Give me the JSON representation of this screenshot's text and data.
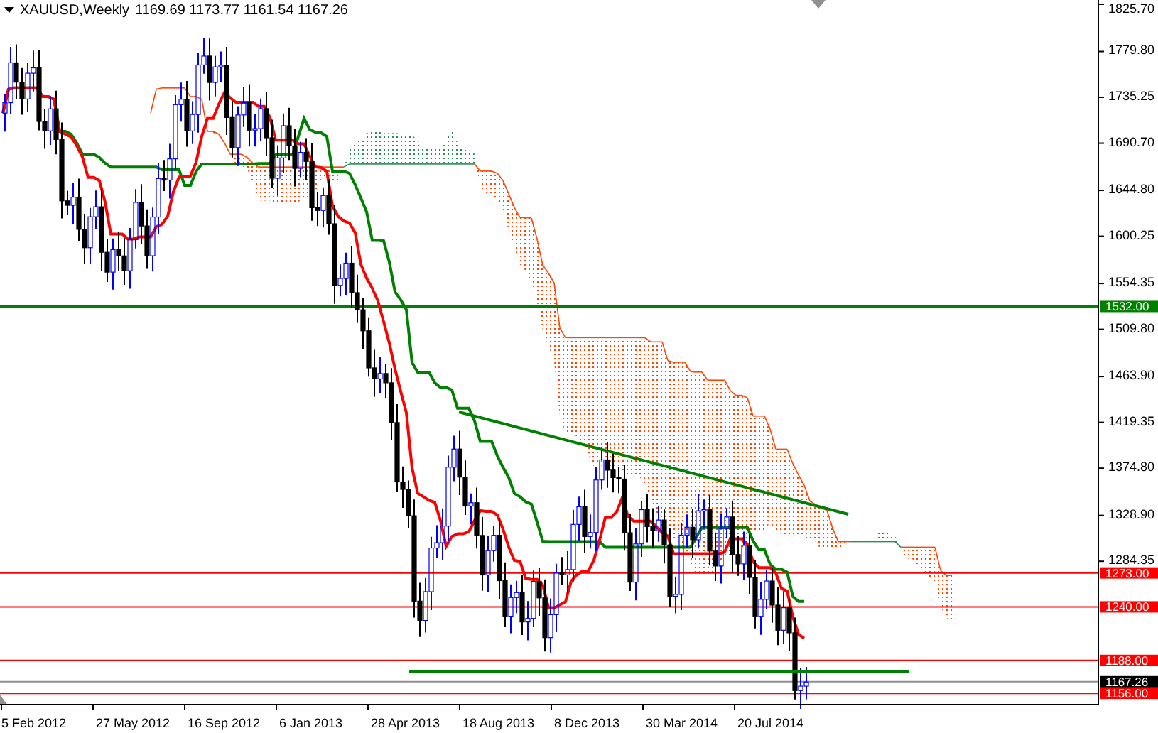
{
  "chart": {
    "symbol": "XAUUSD,Weekly",
    "ohlc": "1169.69 1173.77 1161.54 1167.26",
    "price_ticks": [
      "1825.70",
      "1779.80",
      "1735.25",
      "1690.70",
      "1644.80",
      "1600.25",
      "1554.35",
      "1509.80",
      "1463.90",
      "1419.35",
      "1374.80",
      "1328.90",
      "1284.35"
    ],
    "levels": [
      {
        "label": "1532.00",
        "color": "#008000"
      },
      {
        "label": "1273.00",
        "color": "#ff0000"
      },
      {
        "label": "1240.00",
        "color": "#ff0000"
      },
      {
        "label": "1188.00",
        "color": "#ff0000"
      },
      {
        "label": "1167.26",
        "color": "#000000"
      },
      {
        "label": "1156.00",
        "color": "#ff0000"
      }
    ],
    "dates": [
      "5 Feb 2012",
      "27 May 2012",
      "16 Sep 2012",
      "6 Jan 2013",
      "28 Apr 2013",
      "18 Aug 2013",
      "8 Dec 2013",
      "30 Mar 2014",
      "20 Jul 2014"
    ]
  }
}
